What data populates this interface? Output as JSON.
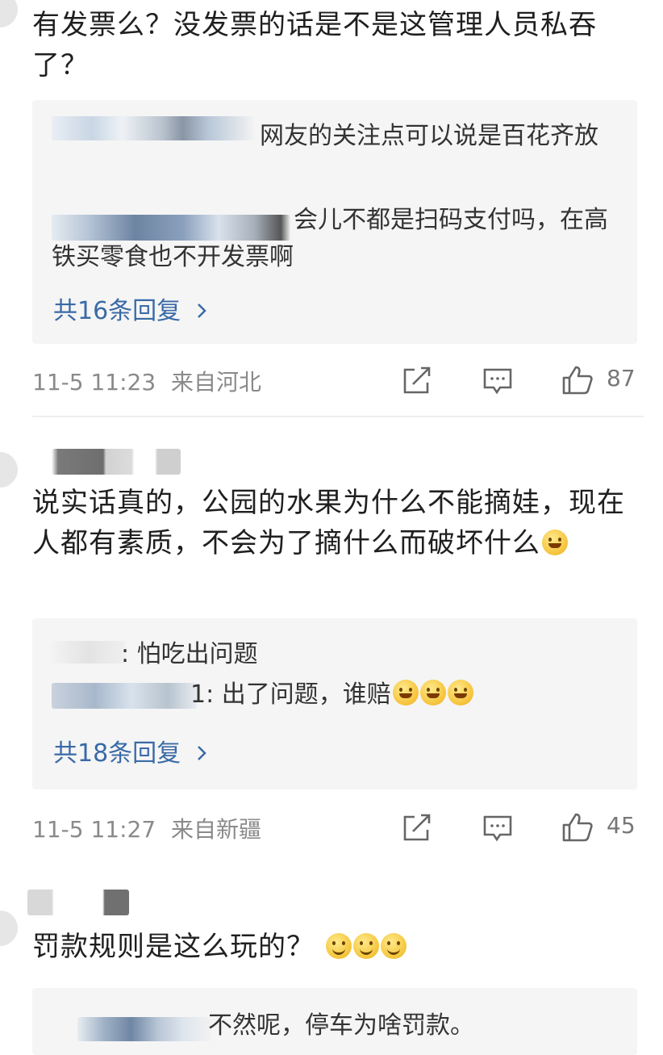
{
  "comments": [
    {
      "text": "有发票么？没发票的话是不是这管理人员私吞了？",
      "replies": [
        {
          "text": "网友的关注点可以说是百花齐放"
        },
        {
          "text": "会儿不都是扫码支付吗，在高铁买零食也不开发票啊"
        }
      ],
      "more_replies": "共16条回复",
      "time": "11-5 11:23",
      "location": "来自河北",
      "likes": "87"
    },
    {
      "text": "说实话真的，公园的水果为什么不能摘娃，现在人都有素质，不会为了摘什么而破坏什么",
      "replies": [
        {
          "text": ": 怕吃出问题"
        },
        {
          "text": "1: 出了问题，谁赔"
        }
      ],
      "more_replies": "共18条回复",
      "time": "11-5 11:27",
      "location": "来自新疆",
      "likes": "45"
    },
    {
      "text": "罚款规则是这么玩的？",
      "replies": [
        {
          "text": "不然呢，停车为啥罚款。"
        }
      ]
    }
  ],
  "icons": {
    "share": "share-icon",
    "comment": "comment-icon",
    "like": "thumbs-up-icon",
    "chevron": "chevron-right-icon",
    "emoji_laugh": "laugh-cry-emoji-icon",
    "emoji_smile": "smile-emoji-icon"
  },
  "colors": {
    "link": "#3a6aa6",
    "meta": "#8a8a8a",
    "reply_bg": "#f5f5f5"
  }
}
